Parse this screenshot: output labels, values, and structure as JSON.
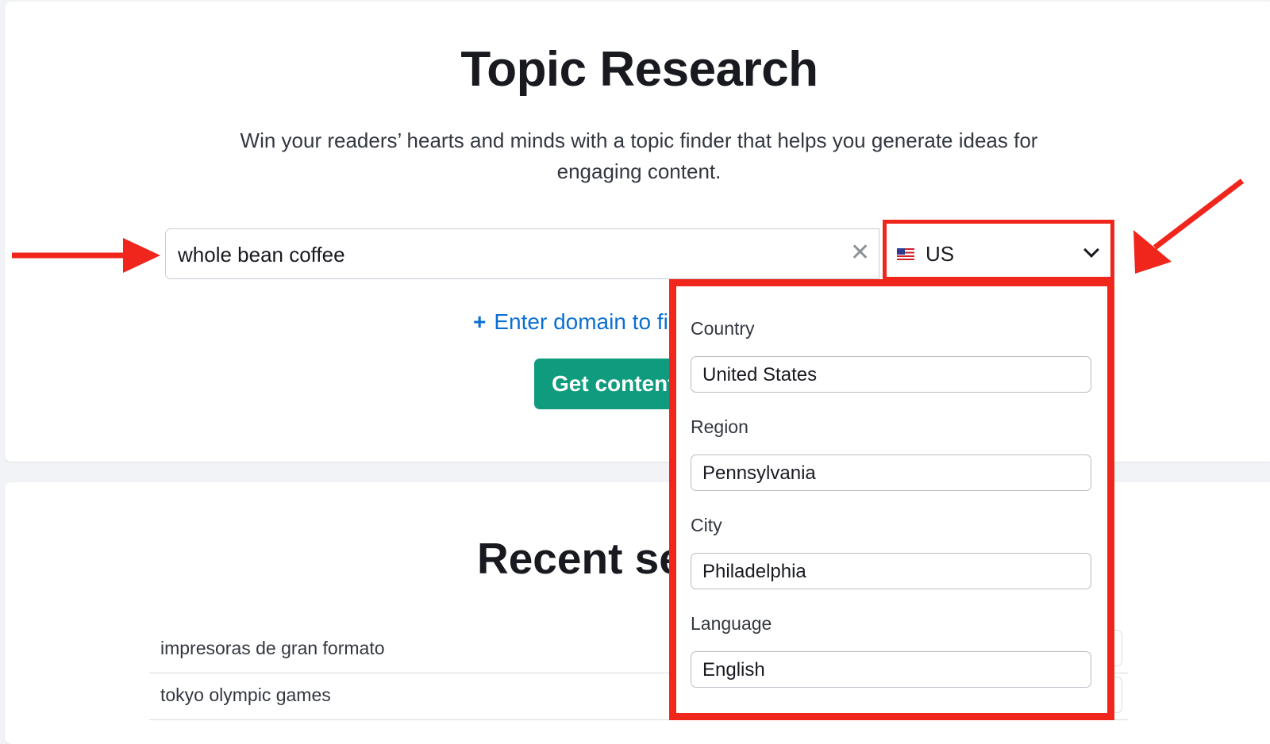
{
  "header": {
    "title": "Topic Research",
    "subtitle": "Win your readers’ hearts and minds with a topic finder that helps you generate ideas for engaging content."
  },
  "search": {
    "value": "whole bean coffee",
    "clear_icon": "close-icon"
  },
  "database": {
    "flag_icon": "us-flag-icon",
    "label": "US",
    "chevron_icon": "chevron-down-icon"
  },
  "domain_link": {
    "icon": "plus-icon",
    "plus": "+",
    "label": "Enter domain to fi"
  },
  "button": {
    "label": "Get content"
  },
  "recent": {
    "title": "Recent se",
    "items": [
      "impresoras de gran formato",
      "tokyo olympic games"
    ]
  },
  "location_dropdown": {
    "country_label": "Country",
    "country_value": "United States",
    "region_label": "Region",
    "region_value": "Pennsylvania",
    "city_label": "City",
    "city_value": "Philadelphia",
    "language_label": "Language",
    "language_value": "English"
  },
  "colors": {
    "annotation": "#f0261c",
    "button": "#0f9c7e",
    "link": "#0a6fd1"
  }
}
